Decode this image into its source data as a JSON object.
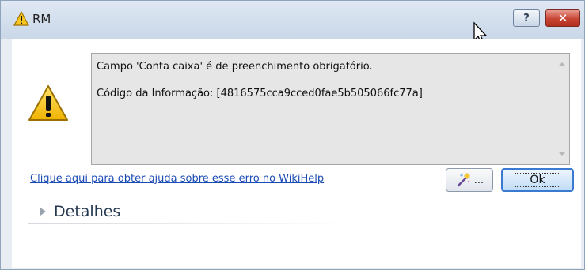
{
  "window": {
    "title": "RM",
    "help_button_label": "?",
    "close_button_label": "✕"
  },
  "message": {
    "line1": "Campo 'Conta caixa' é de preenchimento obrigatório.",
    "line2": "Código da Informação: [4816575cca9cced0fae5b505066fc77a]"
  },
  "help_link": "Clique aqui para obter ajuda sobre esse erro no WikiHelp",
  "buttons": {
    "extra_label": "...",
    "ok_label": "Ok"
  },
  "details": {
    "label": "Detalhes"
  },
  "icons": {
    "title": "warning-icon",
    "main": "warning-icon",
    "extra_button": "wand-icon"
  },
  "colors": {
    "warning_fill": "#f7c520",
    "close_button": "#c74433",
    "link": "#1a4bb5"
  }
}
